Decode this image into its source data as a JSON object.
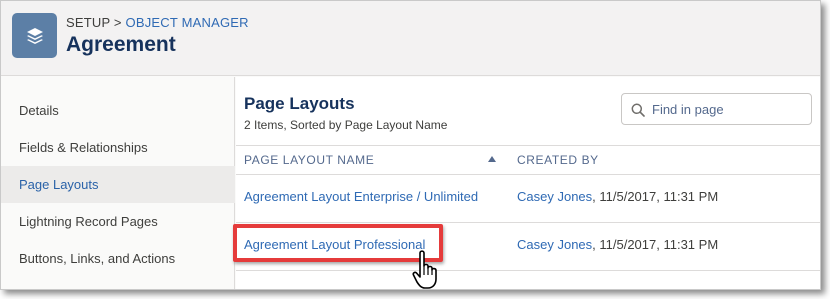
{
  "header": {
    "breadcrumb_setup": "SETUP",
    "breadcrumb_sep": ">",
    "breadcrumb_object_manager": "OBJECT MANAGER",
    "title": "Agreement",
    "icon": "stacked-layers-icon"
  },
  "sidebar": {
    "items": [
      {
        "label": "Details",
        "active": false
      },
      {
        "label": "Fields & Relationships",
        "active": false
      },
      {
        "label": "Page Layouts",
        "active": true
      },
      {
        "label": "Lightning Record Pages",
        "active": false
      },
      {
        "label": "Buttons, Links, and Actions",
        "active": false
      }
    ]
  },
  "main": {
    "title": "Page Layouts",
    "subtitle": "2 Items, Sorted by Page Layout Name",
    "search": {
      "placeholder": "Find in page",
      "value": ""
    },
    "table": {
      "columns": [
        "PAGE LAYOUT NAME",
        "CREATED BY"
      ],
      "sort": {
        "column": "PAGE LAYOUT NAME",
        "direction": "ascending"
      },
      "rows": [
        {
          "name": "Agreement Layout Enterprise / Unlimited",
          "created_by_user": "Casey Jones",
          "created_date": ", 11/5/2017, 11:31 PM"
        },
        {
          "name": "Agreement Layout Professional",
          "created_by_user": "Casey Jones",
          "created_date": ", 11/5/2017, 11:31 PM"
        }
      ]
    }
  },
  "colors": {
    "accent_link": "#2f6ab4",
    "highlight": "#e53b3b",
    "object_icon_bg": "#5c7fa6",
    "active_nav_bg": "#ecebea"
  }
}
